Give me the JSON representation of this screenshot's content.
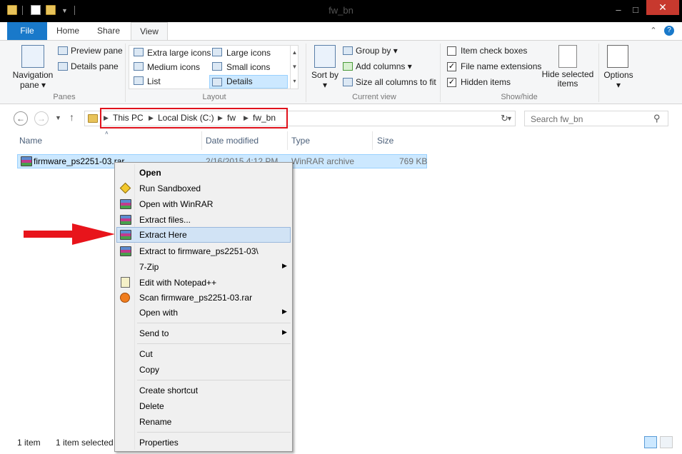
{
  "window": {
    "title": "fw_bn",
    "minimize_glyph": "–",
    "maximize_glyph": "□",
    "close_glyph": "✕"
  },
  "ribbon_tabs": [
    "File",
    "Home",
    "Share",
    "View"
  ],
  "help_glyph": "?",
  "ribbon": {
    "panes": {
      "navigation_pane": "Navigation pane",
      "preview_pane": "Preview pane",
      "details_pane": "Details pane",
      "group_label": "Panes"
    },
    "layout": {
      "items": [
        "Extra large icons",
        "Large icons",
        "Medium icons",
        "Small icons",
        "List",
        "Details"
      ],
      "selected": "Details",
      "group_label": "Layout"
    },
    "current_view": {
      "sort_by": "Sort by",
      "group_by": "Group by",
      "add_columns": "Add columns",
      "size_all_columns": "Size all columns to fit",
      "group_label": "Current view"
    },
    "show_hide": {
      "item_check_boxes": {
        "label": "Item check boxes",
        "checked": false
      },
      "file_name_extensions": {
        "label": "File name extensions",
        "checked": true
      },
      "hidden_items": {
        "label": "Hidden items",
        "checked": true
      },
      "hide_selected": "Hide selected items",
      "group_label": "Show/hide"
    },
    "options": "Options"
  },
  "address": {
    "crumbs": [
      "This PC",
      "Local Disk (C:)",
      "fw",
      "fw_bn"
    ],
    "search_placeholder": "Search fw_bn",
    "highlight_color": "#e0121c"
  },
  "columns": [
    "Name",
    "Date modified",
    "Type",
    "Size"
  ],
  "files": [
    {
      "name": "firmware_ps2251-03.rar",
      "date": "2/16/2015 4:12 PM",
      "type": "WinRAR archive",
      "size": "769 KB"
    }
  ],
  "status": {
    "count": "1 item",
    "selected": "1 item selected"
  },
  "context_menu": {
    "items": [
      {
        "label": "Open",
        "bold": true
      },
      {
        "label": "Run Sandboxed",
        "icon": "sandbox-icon"
      },
      {
        "label": "Open with WinRAR",
        "icon": "winrar-icon"
      },
      {
        "label": "Extract files...",
        "icon": "winrar-icon"
      },
      {
        "label": "Extract Here",
        "icon": "winrar-icon",
        "highlighted": true
      },
      {
        "label": "Extract to firmware_ps2251-03\\",
        "icon": "winrar-icon"
      },
      {
        "label": "7-Zip",
        "submenu": true
      },
      {
        "label": "Edit with Notepad++",
        "icon": "notepad-icon"
      },
      {
        "label": "Scan firmware_ps2251-03.rar",
        "icon": "antivirus-icon"
      },
      {
        "label": "Open with",
        "submenu": true
      },
      {
        "label": "Send to",
        "submenu": true
      },
      {
        "label": "Cut"
      },
      {
        "label": "Copy"
      },
      {
        "label": "Create shortcut"
      },
      {
        "label": "Delete"
      },
      {
        "label": "Rename"
      },
      {
        "label": "Properties"
      }
    ],
    "arrow_color": "#e8141b"
  }
}
